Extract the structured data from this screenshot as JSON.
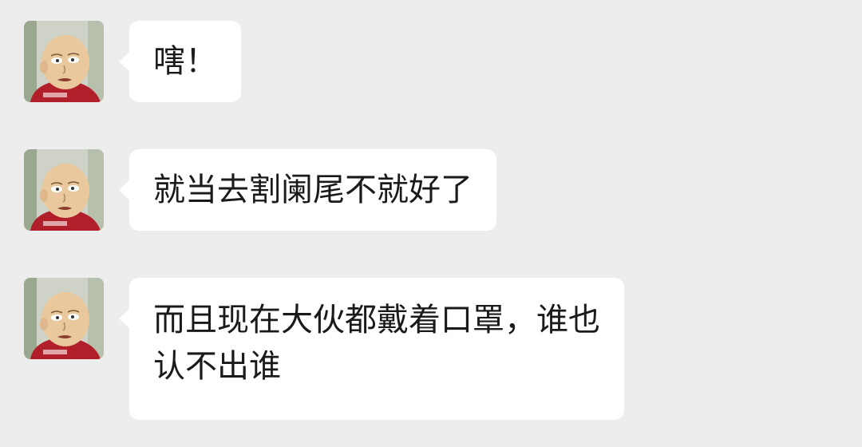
{
  "theme": {
    "background": "#ededed",
    "bubble_color": "#ffffff",
    "text_color": "#1a1a1a"
  },
  "messages": [
    {
      "avatar_icon": "bald-cartoon-man-avatar",
      "lines": [
        "嗐！"
      ]
    },
    {
      "avatar_icon": "bald-cartoon-man-avatar",
      "lines": [
        "就当去割阑尾不就好了"
      ]
    },
    {
      "avatar_icon": "bald-cartoon-man-avatar",
      "lines": [
        "而且现在大伙都戴着口罩，谁也",
        "认不出谁"
      ]
    }
  ]
}
